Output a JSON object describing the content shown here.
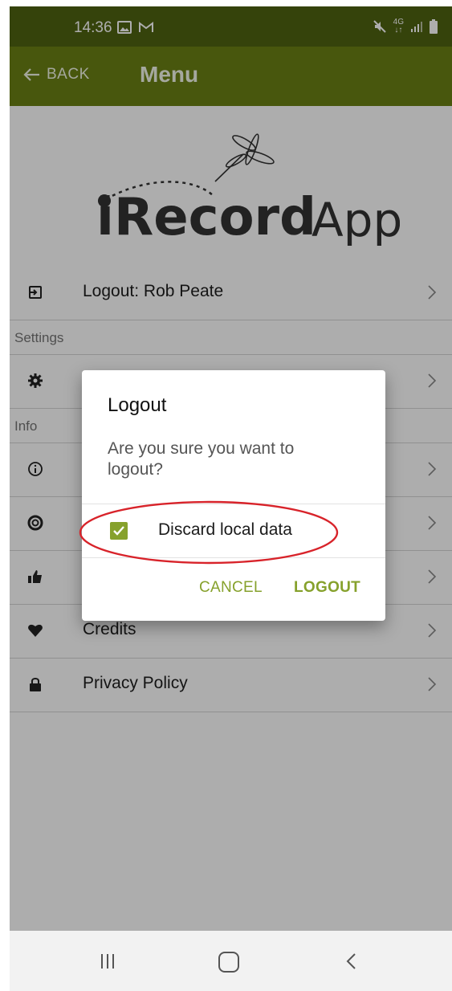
{
  "status_bar": {
    "time": "14:36",
    "icons": [
      "image-icon",
      "gmail-icon",
      "mute-icon",
      "4g-icon",
      "signal-icon",
      "battery-icon"
    ],
    "network": "4G"
  },
  "header": {
    "back_label": "BACK",
    "title": "Menu"
  },
  "logo": {
    "brand": "iRecord",
    "suffix": "App"
  },
  "menu": {
    "logout_item": "Logout: Rob Peate",
    "settings_section": "Settings",
    "info_section": "Info",
    "credits_item": "Credits",
    "privacy_item": "Privacy Policy"
  },
  "dialog": {
    "title": "Logout",
    "message": "Are you sure you want to logout?",
    "checkbox_label": "Discard local data",
    "checkbox_checked": true,
    "cancel_label": "CANCEL",
    "confirm_label": "LOGOUT"
  },
  "colors": {
    "status_bar": "#4f6311",
    "header": "#6b8114",
    "accent": "#86a12c",
    "annotation": "#d8232a"
  }
}
